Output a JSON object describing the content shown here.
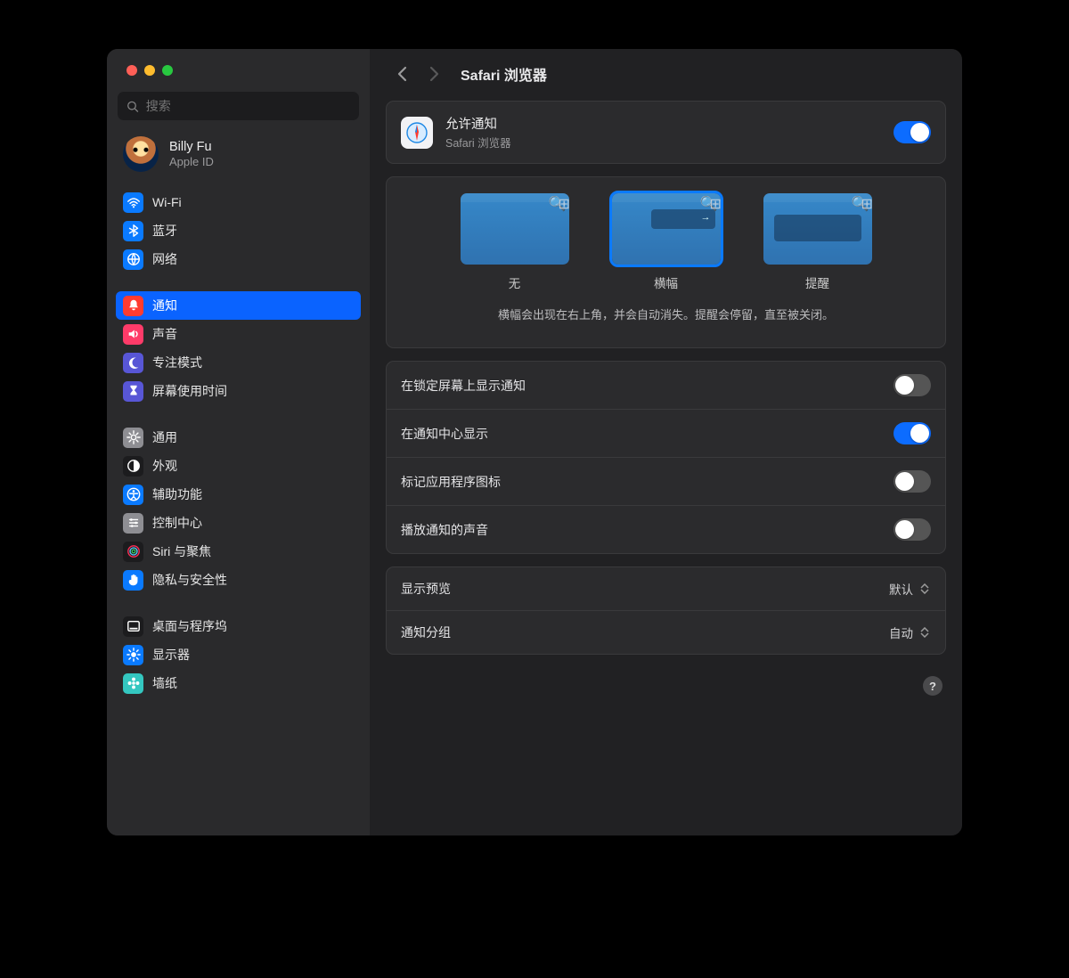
{
  "search": {
    "placeholder": "搜索"
  },
  "profile": {
    "name": "Billy Fu",
    "sub": "Apple ID"
  },
  "sidebar": {
    "groups": [
      [
        {
          "label": "Wi-Fi",
          "icon": "wifi",
          "bg": "#0a7aff"
        },
        {
          "label": "蓝牙",
          "icon": "bluetooth",
          "bg": "#0a7aff"
        },
        {
          "label": "网络",
          "icon": "globe",
          "bg": "#0a7aff"
        }
      ],
      [
        {
          "label": "通知",
          "icon": "bell",
          "bg": "#ff3b30",
          "sel": true
        },
        {
          "label": "声音",
          "icon": "speaker",
          "bg": "#ff3b69"
        },
        {
          "label": "专注模式",
          "icon": "moon",
          "bg": "#5856d6"
        },
        {
          "label": "屏幕使用时间",
          "icon": "hourglass",
          "bg": "#5856d6"
        }
      ],
      [
        {
          "label": "通用",
          "icon": "gear",
          "bg": "#8e8e93"
        },
        {
          "label": "外观",
          "icon": "appearance",
          "bg": "#1c1c1e"
        },
        {
          "label": "辅助功能",
          "icon": "accessibility",
          "bg": "#0a7aff"
        },
        {
          "label": "控制中心",
          "icon": "sliders",
          "bg": "#8e8e93"
        },
        {
          "label": "Siri 与聚焦",
          "icon": "siri",
          "bg": "#1c1c1e"
        },
        {
          "label": "隐私与安全性",
          "icon": "hand",
          "bg": "#0a7aff"
        }
      ],
      [
        {
          "label": "桌面与程序坞",
          "icon": "dock",
          "bg": "#1c1c1e"
        },
        {
          "label": "显示器",
          "icon": "brightness",
          "bg": "#0a7aff"
        },
        {
          "label": "墙纸",
          "icon": "flower",
          "bg": "#34c7c0"
        }
      ]
    ]
  },
  "header": {
    "title": "Safari 浏览器"
  },
  "allow": {
    "title": "允许通知",
    "sub": "Safari 浏览器",
    "on": true
  },
  "styles": {
    "opts": [
      {
        "label": "无",
        "kind": "none"
      },
      {
        "label": "横幅",
        "kind": "banner",
        "sel": true
      },
      {
        "label": "提醒",
        "kind": "alert"
      }
    ],
    "desc": "横幅会出现在右上角，并会自动消失。提醒会停留，直至被关闭。"
  },
  "toggles": [
    {
      "label": "在锁定屏幕上显示通知",
      "on": false
    },
    {
      "label": "在通知中心显示",
      "on": true
    },
    {
      "label": "标记应用程序图标",
      "on": false
    },
    {
      "label": "播放通知的声音",
      "on": false
    }
  ],
  "selects": [
    {
      "label": "显示预览",
      "value": "默认"
    },
    {
      "label": "通知分组",
      "value": "自动"
    }
  ]
}
